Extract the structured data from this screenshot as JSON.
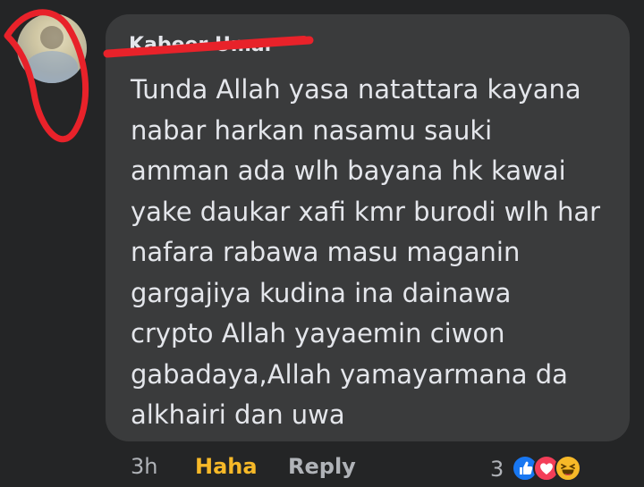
{
  "comment": {
    "author": "Kabeer Umar",
    "text": "Tunda Allah yasa natattara kayana\nnabar harkan nasamu sauki\namman ada wlh bayana hk kawai\nyake daukar xafi kmr burodi wlh har\nnafara rabawa masu maganin\ngargajiya kudina ina dainawa\ncrypto Allah yayaemin ciwon\ngabadaya,Allah yamayarmana da\nalkhairi dan uwa"
  },
  "actions": {
    "time": "3h",
    "haha_label": "Haha",
    "reply_label": "Reply"
  },
  "reactions": {
    "count": "3",
    "icons": [
      "like-icon",
      "love-icon",
      "haha-icon"
    ]
  },
  "colors": {
    "background": "#242526",
    "bubble": "#3a3b3c",
    "text": "#e4e6eb",
    "secondary_text": "#b0b3b8",
    "haha_accent": "#f7b928",
    "like_blue": "#1877f2",
    "love_red": "#f33e58",
    "redaction_red": "#e8222a"
  }
}
